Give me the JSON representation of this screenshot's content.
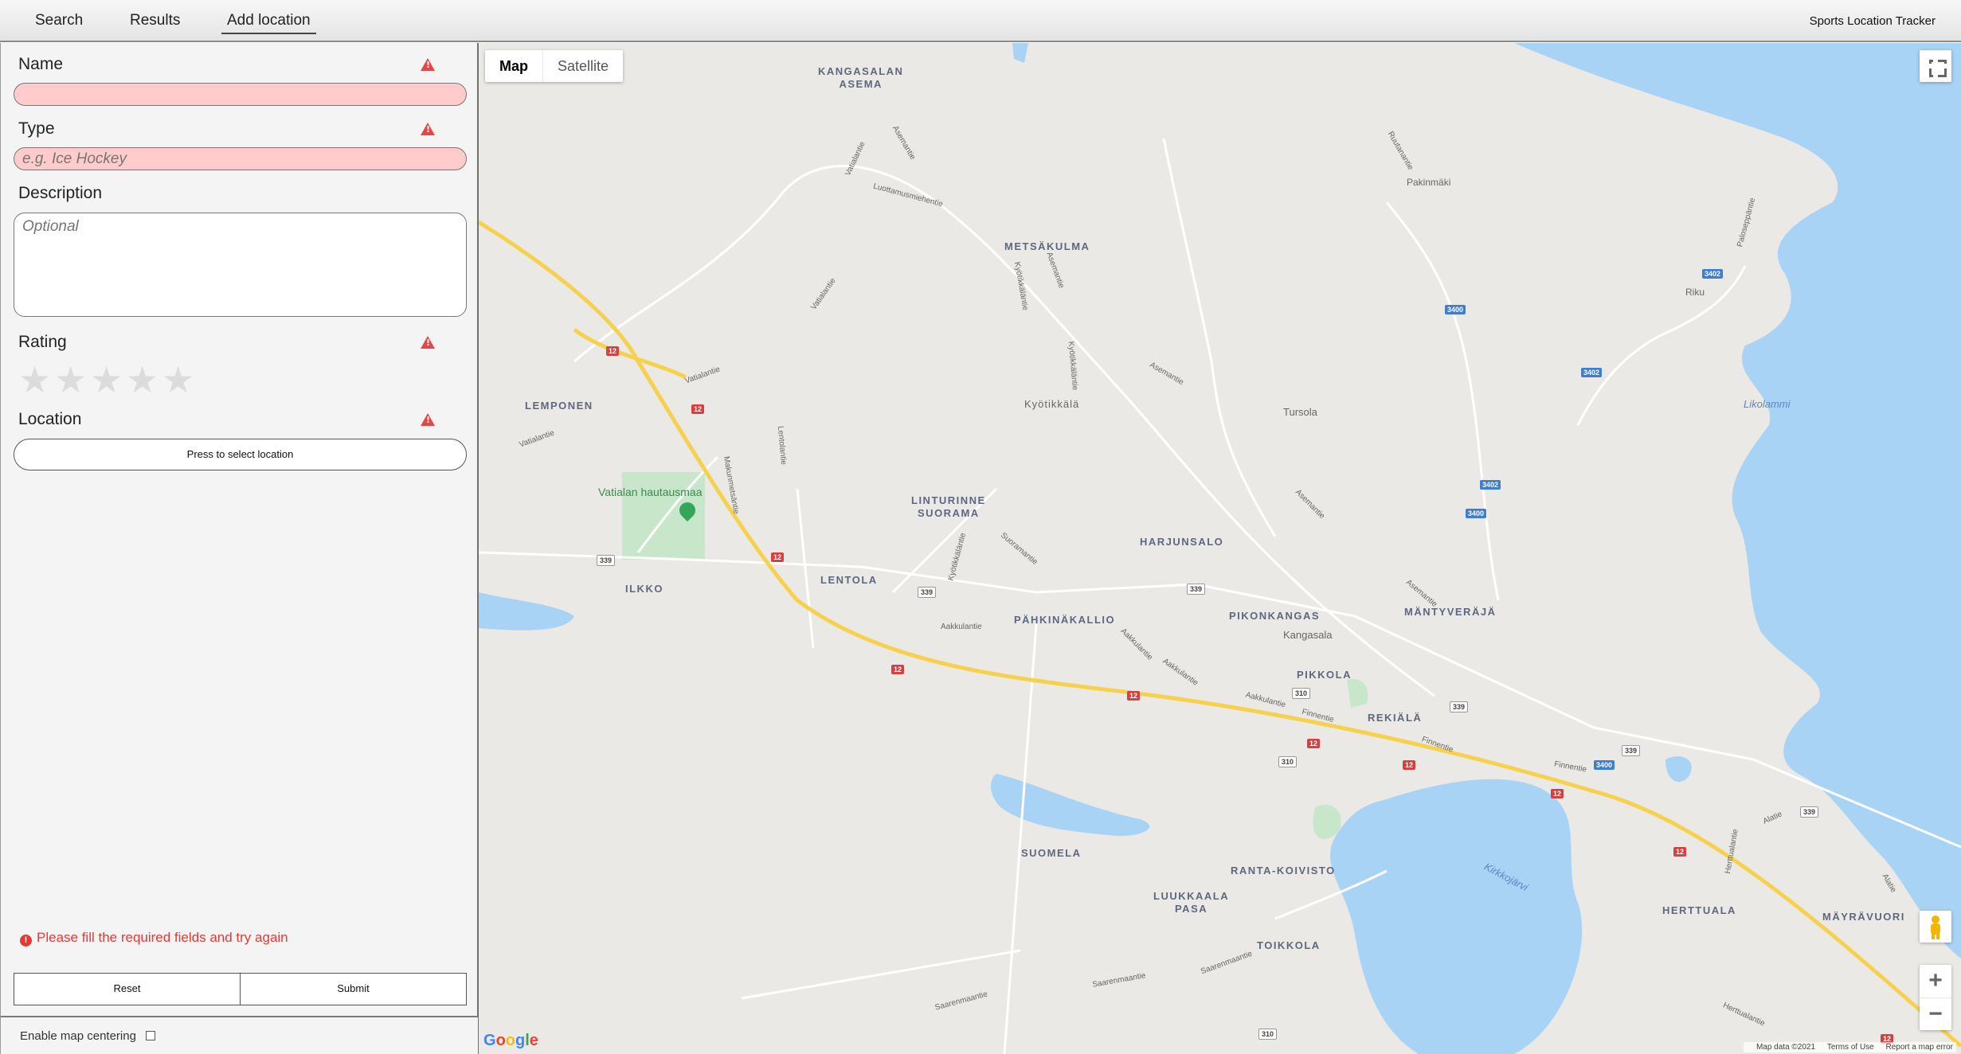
{
  "nav": {
    "tabs": [
      "Search",
      "Results",
      "Add location"
    ],
    "active": "Add location",
    "app_title": "Sports Location Tracker"
  },
  "form": {
    "name_label": "Name",
    "name_value": "",
    "type_label": "Type",
    "type_placeholder": "e.g. Ice Hockey",
    "description_label": "Description",
    "description_placeholder": "Optional",
    "rating_label": "Rating",
    "rating_value": 0,
    "rating_max": 5,
    "location_label": "Location",
    "location_button": "Press to select location",
    "error_message": "Please fill the required fields and try again",
    "reset_label": "Reset",
    "submit_label": "Submit",
    "map_centering_label": "Enable map centering",
    "map_centering_checked": false
  },
  "map": {
    "type_map": "Map",
    "type_satellite": "Satellite",
    "google": "Google",
    "attribution": [
      "Map data ©2021",
      "Terms of Use",
      "Report a map error"
    ],
    "water_color": "#a8d3f5",
    "land_color": "#ebe9e5",
    "park_color": "#c8e6c9",
    "highway_color": "#f6d14e",
    "places": {
      "kangasalan_asema": "KANGASALAN\nASEMA",
      "metsakulma": "METSÄKULMA",
      "pakinmaki": "Pakinmäki",
      "riku": "Riku",
      "likolammi": "Likolammi",
      "lemponen": "LEMPONEN",
      "kyotikkala": "Kyötikkälä",
      "tursola": "Tursola",
      "linturinne": "LINTURINNE\nSUORAMA",
      "harjunsalo": "HARJUNSALO",
      "ilkko": "ILKKO",
      "lentola": "LENTOLA",
      "pahkinakallio": "PÄHKINÄKALLIO",
      "pikonkangas": "PIKONKANGAS",
      "kangasala": "Kangasala",
      "mantyveraja": "MÄNTYVERÄJÄ",
      "pikkola": "PIKKOLA",
      "rekiala": "REKIÄLÄ",
      "suomela": "SUOMELA",
      "ranta_koivisto": "RANTA-KOIVISTO",
      "luukkaala": "LUUKKAALA\nPASA",
      "toikkola": "TOIKKOLA",
      "herttuala": "HERTTUALA",
      "mayravuori": "MÄYRÄVUORI",
      "kirkkojarvi": "Kirkkojärvi",
      "vatialan": "Vatialan hautausmaa"
    },
    "streets": {
      "asemantie": "Asemantie",
      "vatialantie": "Vatialantie",
      "luottamusmiehentie": "Luottamusmiehentie",
      "kyotikkalantie": "Kyötikkäläntie",
      "ruutanantie": "Ruutanantie",
      "lentolantie": "Lentolantie",
      "makunmetsantie": "Makunmetsäntie",
      "suoramantie": "Suoramantie",
      "aakkulantie": "Aakkulantie",
      "finnentie": "Finnentie",
      "saarenmaantie": "Saarenmaantie",
      "alatie": "Alatie",
      "herttualantie": "Herttualantie",
      "paloseppantie": "Paloseppäntie"
    },
    "shields": {
      "r12": "12",
      "w339": "339",
      "w310": "310",
      "b3400": "3400",
      "b3402": "3402"
    }
  }
}
